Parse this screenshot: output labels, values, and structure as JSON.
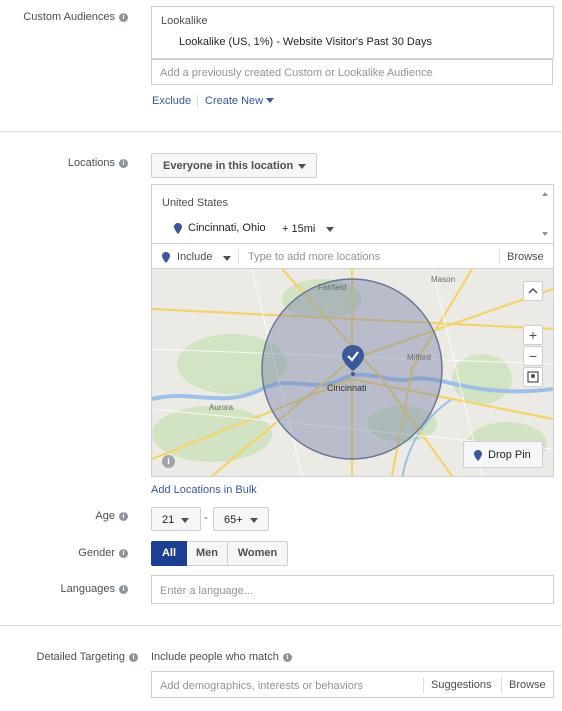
{
  "custom_audiences": {
    "label": "Custom Audiences",
    "group_title": "Lookalike",
    "item": "Lookalike (US, 1%) - Website Visitor's Past 30 Days",
    "placeholder": "Add a previously created Custom or Lookalike Audience",
    "exclude": "Exclude",
    "create_new": "Create New"
  },
  "locations": {
    "label": "Locations",
    "dropdown": "Everyone in this location",
    "country": "United States",
    "city": "Cincinnati, Ohio",
    "radius": "+ 15mi",
    "include": "Include",
    "placeholder": "Type to add more locations",
    "browse": "Browse",
    "add_bulk": "Add Locations in Bulk",
    "map": {
      "labels": [
        "Fairfield",
        "Mason",
        "Milford",
        "Cincinnati",
        "Aurora"
      ],
      "drop_pin": "Drop Pin"
    }
  },
  "age": {
    "label": "Age",
    "min": "21",
    "max": "65+",
    "separator": "-"
  },
  "gender": {
    "label": "Gender",
    "options": [
      "All",
      "Men",
      "Women"
    ],
    "selected": "All"
  },
  "languages": {
    "label": "Languages",
    "placeholder": "Enter a language..."
  },
  "detailed_targeting": {
    "label": "Detailed Targeting",
    "subtitle": "Include people who match",
    "placeholder": "Add demographics, interests or behaviors",
    "suggestions": "Suggestions",
    "browse": "Browse"
  },
  "colors": {
    "accent": "#365899",
    "selected": "#1c3f94",
    "map_circle": "#8a95b8",
    "pin": "#3b5998"
  }
}
